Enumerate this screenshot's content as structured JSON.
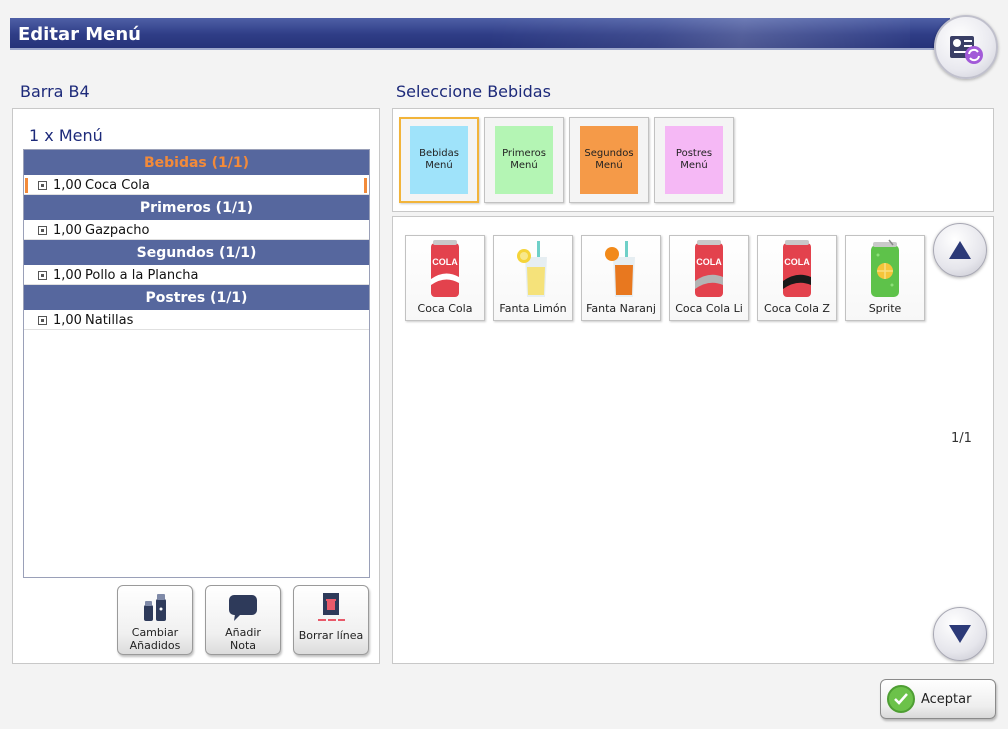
{
  "window": {
    "title": "Editar Menú"
  },
  "left": {
    "title": "Barra B4",
    "menu_count": "1 x Menú",
    "groups": [
      {
        "header": "Bebidas (1/1)",
        "qty": "1,00",
        "item": "Coca Cola"
      },
      {
        "header": "Primeros (1/1)",
        "qty": "1,00",
        "item": "Gazpacho"
      },
      {
        "header": "Segundos (1/1)",
        "qty": "1,00",
        "item": "Pollo a la Plancha"
      },
      {
        "header": "Postres (1/1)",
        "qty": "1,00",
        "item": "Natillas"
      }
    ],
    "actions": {
      "change_line1": "Cambiar",
      "change_line2": "Añadidos",
      "note_line1": "Añadir",
      "note_line2": "Nota",
      "delete": "Borrar línea"
    }
  },
  "right": {
    "title": "Seleccione Bebidas",
    "categories": [
      {
        "line1": "Bebidas",
        "line2": "Menú",
        "color": "#9fe3fa"
      },
      {
        "line1": "Primeros",
        "line2": "Menú",
        "color": "#b4f5b4"
      },
      {
        "line1": "Segundos",
        "line2": "Menú",
        "color": "#f59a48"
      },
      {
        "line1": "Postres",
        "line2": "Menú",
        "color": "#f5b8f5"
      }
    ],
    "products": [
      {
        "label": "Coca Cola",
        "icon": "cola-can-icon"
      },
      {
        "label": "Fanta Limón",
        "icon": "lemon-drink-icon"
      },
      {
        "label": "Fanta Naranj",
        "icon": "orange-drink-icon"
      },
      {
        "label": "Coca  Cola Li",
        "icon": "cola-light-can-icon"
      },
      {
        "label": "Coca  Cola Z",
        "icon": "cola-zero-can-icon"
      },
      {
        "label": "Sprite",
        "icon": "sprite-can-icon"
      }
    ],
    "page": "1/1"
  },
  "footer": {
    "accept": "Aceptar"
  },
  "colors": {
    "accent": "#f28a3a",
    "header": "#56679e",
    "title_blue": "#1d2a7a"
  }
}
